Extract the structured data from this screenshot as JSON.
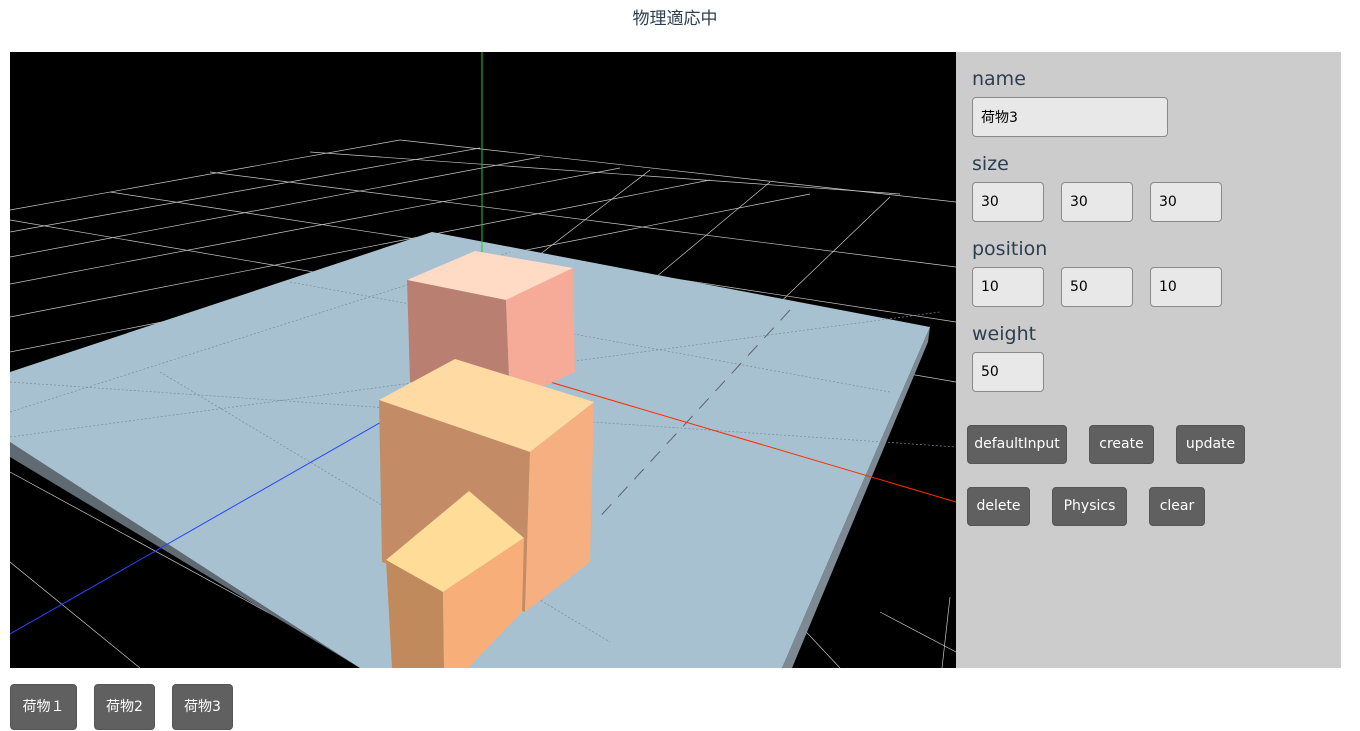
{
  "header": {
    "title": "物理適応中"
  },
  "scene": {
    "background_color": "#000000",
    "plane_color": "#a8c1d0",
    "grid_color": "#c8c8c8",
    "axis_colors": {
      "x": "#ff2a00",
      "y": "#22cc22",
      "z": "#2244ff"
    },
    "boxes": [
      {
        "name": "荷物３",
        "top": "#ffdac4",
        "front": "#b98072",
        "side": "#f6ab98"
      },
      {
        "name": "荷物２",
        "top": "#ffdba3",
        "front": "#c38c66",
        "side": "#f6af80"
      },
      {
        "name": "荷物１",
        "top": "#ffdc97",
        "front": "#c18a5c",
        "side": "#f7ae78"
      }
    ]
  },
  "panel": {
    "name_label": "name",
    "name_value": "荷物3",
    "size_label": "size",
    "size_values": [
      "30",
      "30",
      "30"
    ],
    "position_label": "position",
    "position_values": [
      "10",
      "50",
      "10"
    ],
    "weight_label": "weight",
    "weight_value": "50",
    "buttons": {
      "default_input": "defaultInput",
      "create": "create",
      "update": "update",
      "delete": "delete",
      "physics": "Physics",
      "clear": "clear"
    }
  },
  "items": [
    "荷物１",
    "荷物2",
    "荷物3"
  ]
}
